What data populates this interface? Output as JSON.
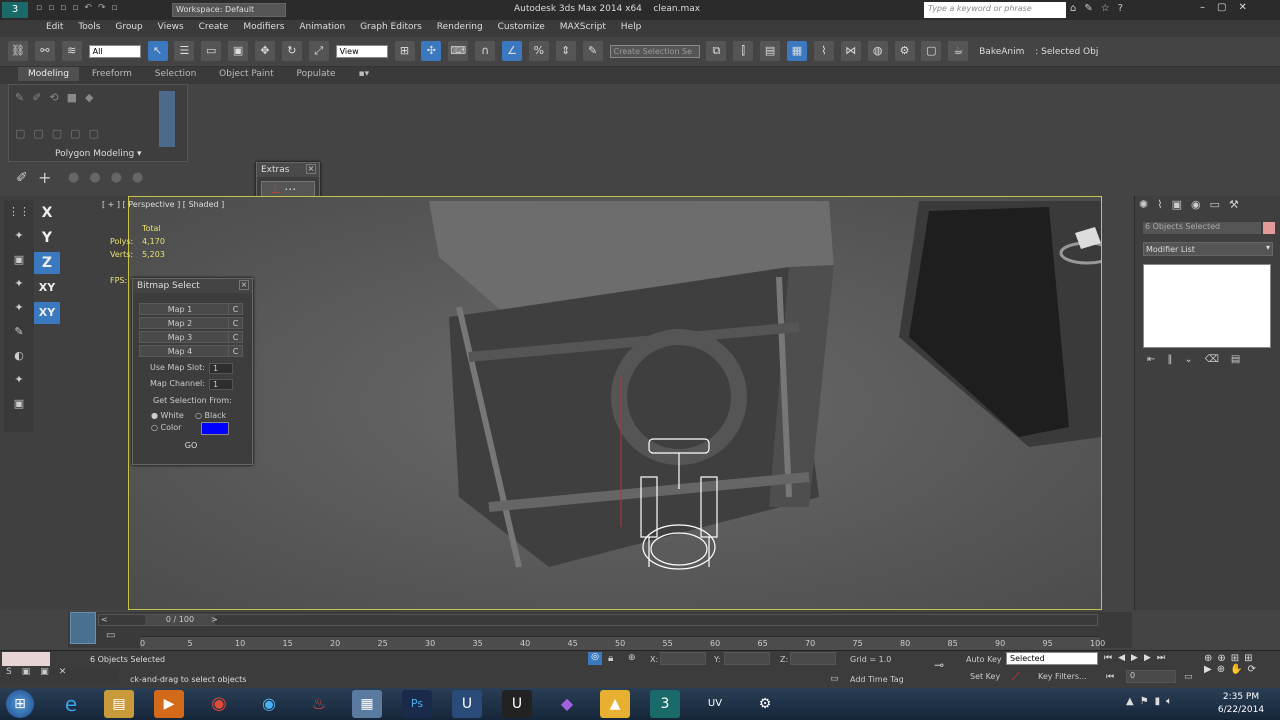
{
  "title_bar": {
    "workspace": "Workspace: Default",
    "app_title": "Autodesk 3ds Max  2014 x64",
    "file": "clean.max",
    "search_placeholder": "Type a keyword or phrase"
  },
  "menu": [
    "Edit",
    "Tools",
    "Group",
    "Views",
    "Create",
    "Modifiers",
    "Animation",
    "Graph Editors",
    "Rendering",
    "Customize",
    "MAXScript",
    "Help"
  ],
  "toolbar": {
    "filter": "All",
    "ref_coord": "View",
    "named_selection": "Create Selection Se",
    "bake_anim": "BakeAnim",
    "selected_obj": ": Selected Obj"
  },
  "ribbon": {
    "tabs": [
      "Modeling",
      "Freeform",
      "Selection",
      "Object Paint",
      "Populate"
    ],
    "panel_label": "Polygon Modeling"
  },
  "extras": {
    "title": "Extras"
  },
  "viewport": {
    "label": "[ + ] [ Perspective ] [ Shaded ]",
    "total_label": "Total",
    "polys_label": "Polys:",
    "polys": "4,170",
    "verts_label": "Verts:",
    "verts": "5,203",
    "fps_label": "FPS:"
  },
  "axis": [
    "X",
    "Y",
    "Z",
    "XY",
    "XY"
  ],
  "bitmap_select": {
    "title": "Bitmap Select",
    "maps": [
      "Map 1",
      "Map 2",
      "Map 3",
      "Map 4"
    ],
    "clear": "C",
    "use_map_slot": "Use Map Slot:",
    "map_slot_value": "1",
    "map_channel": "Map Channel:",
    "map_channel_value": "1",
    "get_from": "Get Selection From:",
    "white": "White",
    "black": "Black",
    "color": "Color",
    "swatch": "#0000ff",
    "go": "GO"
  },
  "command_panel": {
    "selection_name": "6 Objects Selected",
    "modifier_list": "Modifier List"
  },
  "timeline": {
    "frame": "0 / 100",
    "ticks": [
      "0",
      "5",
      "10",
      "15",
      "20",
      "25",
      "30",
      "35",
      "40",
      "45",
      "50",
      "55",
      "60",
      "65",
      "70",
      "75",
      "80",
      "85",
      "90",
      "95",
      "100"
    ]
  },
  "status": {
    "selected": "6 Objects Selected",
    "prompt": "ck-and-drag to select objects",
    "x_label": "X:",
    "y_label": "Y:",
    "z_label": "Z:",
    "grid": "Grid = 1.0",
    "add_time_tag": "Add Time Tag",
    "auto_key": "Auto Key",
    "auto_key_mode": "Selected",
    "set_key": "Set Key",
    "key_filters": "Key Filters...",
    "frame_field": "0"
  },
  "taskbar": {
    "time": "2:35 PM",
    "date": "6/22/2014"
  }
}
